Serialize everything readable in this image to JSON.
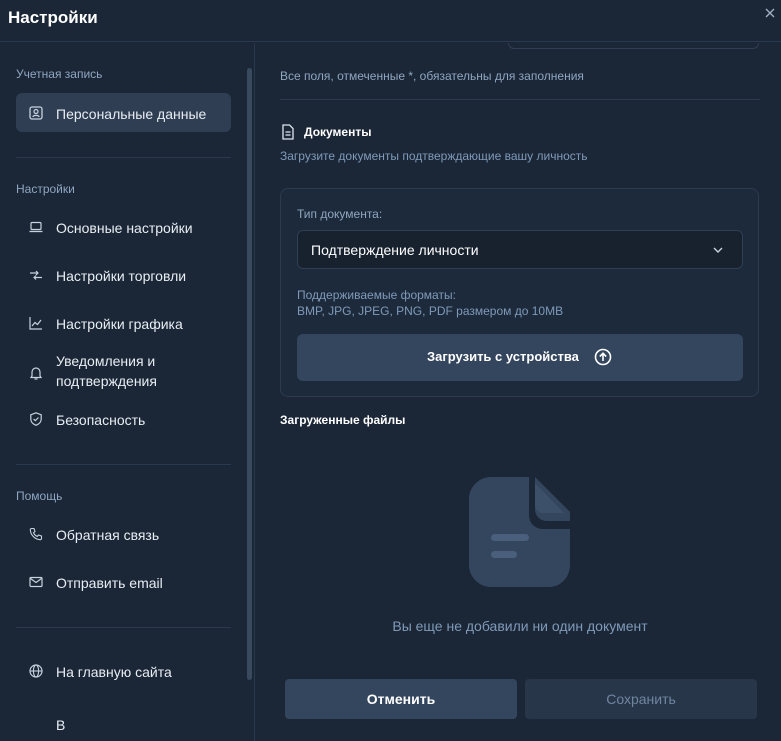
{
  "header": {
    "title": "Настройки"
  },
  "sidebar": {
    "sections": {
      "account": "Учетная запись",
      "settings": "Настройки",
      "help": "Помощь"
    },
    "items": {
      "personal": "Персональные данные",
      "general": "Основные настройки",
      "trading": "Настройки торговли",
      "chart": "Настройки графика",
      "notifications": "Уведомления и подтверждения",
      "security": "Безопасность",
      "feedback": "Обратная связь",
      "email": "Отправить email",
      "home": "На главную сайта",
      "partial": "В"
    }
  },
  "main": {
    "required_note": "Все поля, отмеченные *, обязательны для заполнения",
    "documents": {
      "title": "Документы",
      "subtitle": "Загрузите документы подтверждающие вашу личность",
      "type_label": "Тип документа:",
      "type_value": "Подтверждение личности",
      "formats_label": "Поддерживаемые форматы:",
      "formats_value": "BMP, JPG, JPEG, PNG, PDF размером до 10MB",
      "upload_label": "Загрузить с устройства"
    },
    "uploaded": {
      "title": "Загруженные файлы",
      "empty_text": "Вы еще не добавили ни один документ"
    },
    "actions": {
      "cancel": "Отменить",
      "save": "Сохранить"
    }
  },
  "colors": {
    "background": "#1b2737",
    "active_item": "#2f3e53",
    "button": "#34465e",
    "muted_text": "#7f9ab8"
  }
}
